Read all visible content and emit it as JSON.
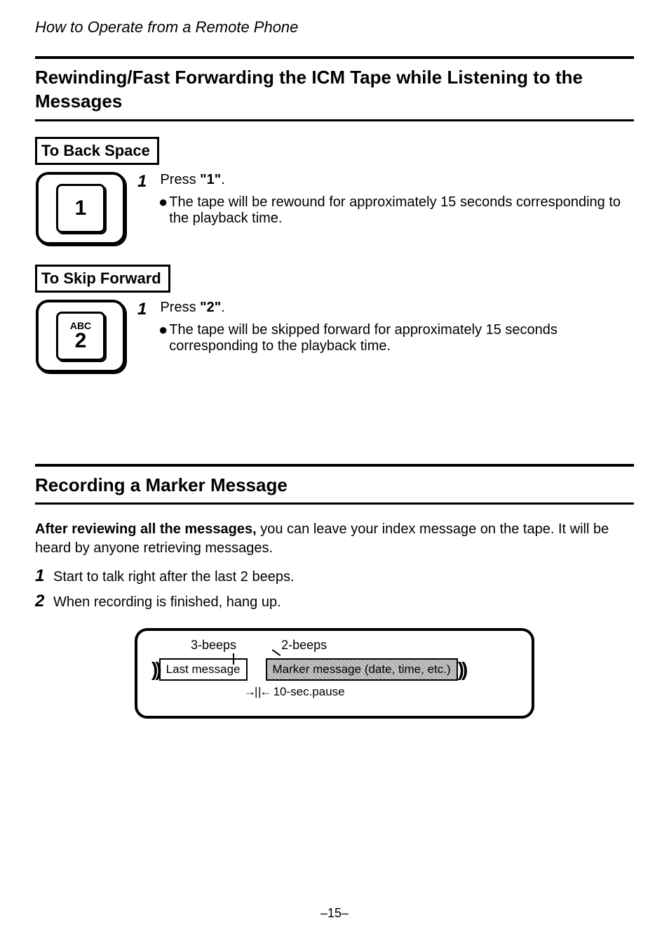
{
  "header": "How to Operate from a Remote Phone",
  "section1": {
    "title": "Rewinding/Fast Forwarding the ICM Tape while Listening to the Messages",
    "back": {
      "label": "To Back Space",
      "key_top": "",
      "key_main": "1",
      "step_num": "1",
      "step_text_a": "Press ",
      "step_text_b": "\"1\"",
      "step_text_c": ".",
      "bullet": "The tape will be rewound for approximately 15 seconds corresponding to the playback time."
    },
    "skip": {
      "label": "To Skip Forward",
      "key_top": "ABC",
      "key_main": "2",
      "step_num": "1",
      "step_text_a": "Press ",
      "step_text_b": "\"2\"",
      "step_text_c": ".",
      "bullet": "The tape will be skipped forward for approximately 15 seconds corresponding to the playback time."
    }
  },
  "section2": {
    "title": "Recording a Marker Message",
    "intro_bold": "After reviewing all the messages,",
    "intro_rest": " you can leave your index message on the tape. It will be heard by anyone retrieving messages.",
    "step1_num": "1",
    "step1": "Start to talk right after the last 2 beeps.",
    "step2_num": "2",
    "step2": "When recording is finished, hang up.",
    "diagram": {
      "beeps3": "3-beeps",
      "beeps2": "2-beeps",
      "last": "Last message",
      "marker": "Marker message (date, time, etc.)",
      "pause": "10-sec.pause"
    }
  },
  "page_number": "–15–"
}
